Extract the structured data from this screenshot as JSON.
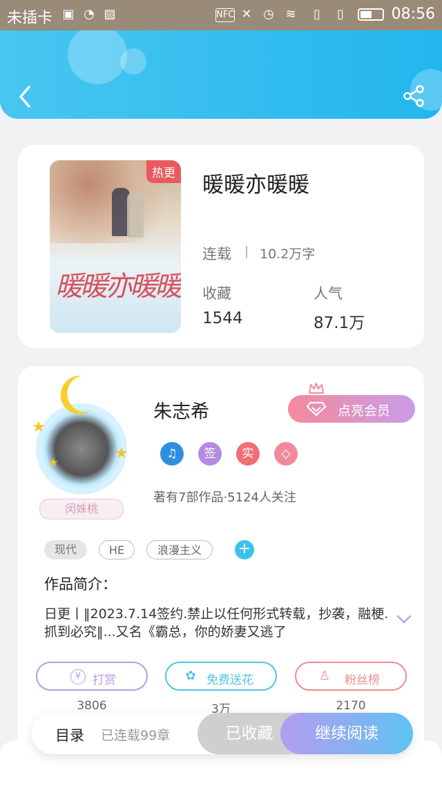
{
  "status_bar": {
    "carrier": "未插卡",
    "time": "08:56",
    "icons": [
      "sim-warning-icon",
      "hotspot-icon",
      "image-icon",
      "nfc-icon",
      "mute-icon",
      "alarm-icon",
      "wifi-icon",
      "sim1-icon",
      "sim2-icon",
      "battery-icon"
    ]
  },
  "header": {
    "back_icon": "back-arrow-icon",
    "share_icon": "share-icon"
  },
  "book": {
    "cover_tag": "热更",
    "cover_title": "暖暖亦暖暖",
    "title": "暖暖亦暖暖",
    "status": "连载",
    "word_count": "10.2万字",
    "favorites_label": "收藏",
    "favorites_value": "1544",
    "popularity_label": "人气",
    "popularity_value": "87.1万"
  },
  "author": {
    "name": "朱志希",
    "nickname_badge": "闵姝桃",
    "vip_button": "点亮会员",
    "badges": [
      {
        "label": "♫",
        "color": "#2d8fe0"
      },
      {
        "label": "签",
        "color": "#b38be0"
      },
      {
        "label": "实",
        "color": "#ef6f74"
      },
      {
        "label": "◇",
        "color": "#f08a9a"
      }
    ],
    "works_info": "著有7部作品·5124人关注"
  },
  "tags": [
    "现代",
    "HE",
    "浪漫主义"
  ],
  "intro": {
    "label": "作品简介：",
    "text": "日更丨‖2023.7.14签约.禁止以任何形式转载，抄袭，融梗.抓到必究‖...又名《霸总，你的娇妻又逃了"
  },
  "actions": [
    {
      "label": "打赏",
      "count": "3806",
      "color": "#b59ce6",
      "icon": "¥"
    },
    {
      "label": "免费送花",
      "count": "3万",
      "color": "#4cc5e8",
      "icon": "✿"
    },
    {
      "label": "粉丝榜",
      "count": "2170",
      "color": "#ee8c8f",
      "icon": "♙"
    }
  ],
  "bottom": {
    "toc": "目录",
    "chapters": "已连载99章",
    "favorited": "已收藏",
    "continue": "继续阅读"
  }
}
